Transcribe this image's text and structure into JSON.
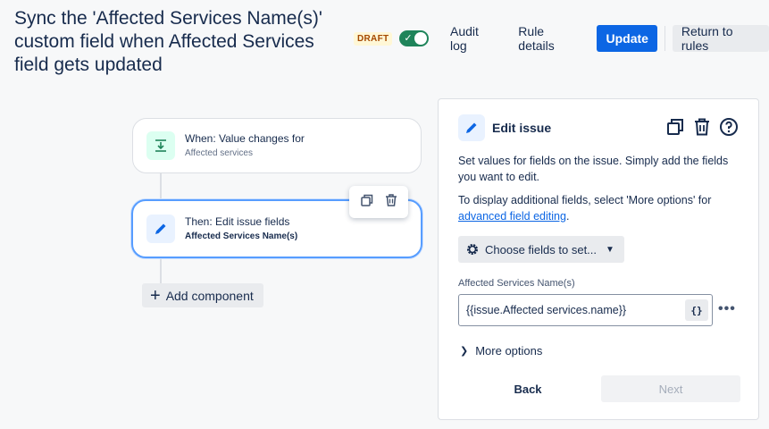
{
  "header": {
    "title": "Sync the 'Affected Services Name(s)' custom field when Affected Services field gets updated",
    "draft_badge": "DRAFT",
    "audit_log": "Audit log",
    "rule_details": "Rule details",
    "update": "Update",
    "return_to_rules": "Return to rules"
  },
  "flow": {
    "trigger": {
      "line1": "When: Value changes for",
      "line2": "Affected services"
    },
    "action": {
      "line1": "Then: Edit issue fields",
      "line2": "Affected Services Name(s)"
    },
    "add_component": "Add component"
  },
  "panel": {
    "title": "Edit issue",
    "description1": "Set values for fields on the issue. Simply add the fields you want to edit.",
    "description2_prefix": "To display additional fields, select 'More options' for",
    "description2_link": "advanced field editing",
    "description2_suffix": ".",
    "choose_fields": "Choose fields to set...",
    "field_label": "Affected Services Name(s)",
    "field_value": "{{issue.Affected services.name}}",
    "smart_value_button": "{}",
    "more_options": "More options",
    "back": "Back",
    "next": "Next"
  },
  "colors": {
    "primary": "#0c66e4",
    "toggle_on": "#1f845a",
    "selected_border": "#579dff",
    "trigger_icon_bg": "#dcfff1"
  },
  "icons": {
    "trigger": "value-change-icon",
    "action": "pencil-icon",
    "copy": "copy-icon",
    "delete": "trash-icon",
    "help": "help-icon",
    "settings": "gear-icon"
  }
}
